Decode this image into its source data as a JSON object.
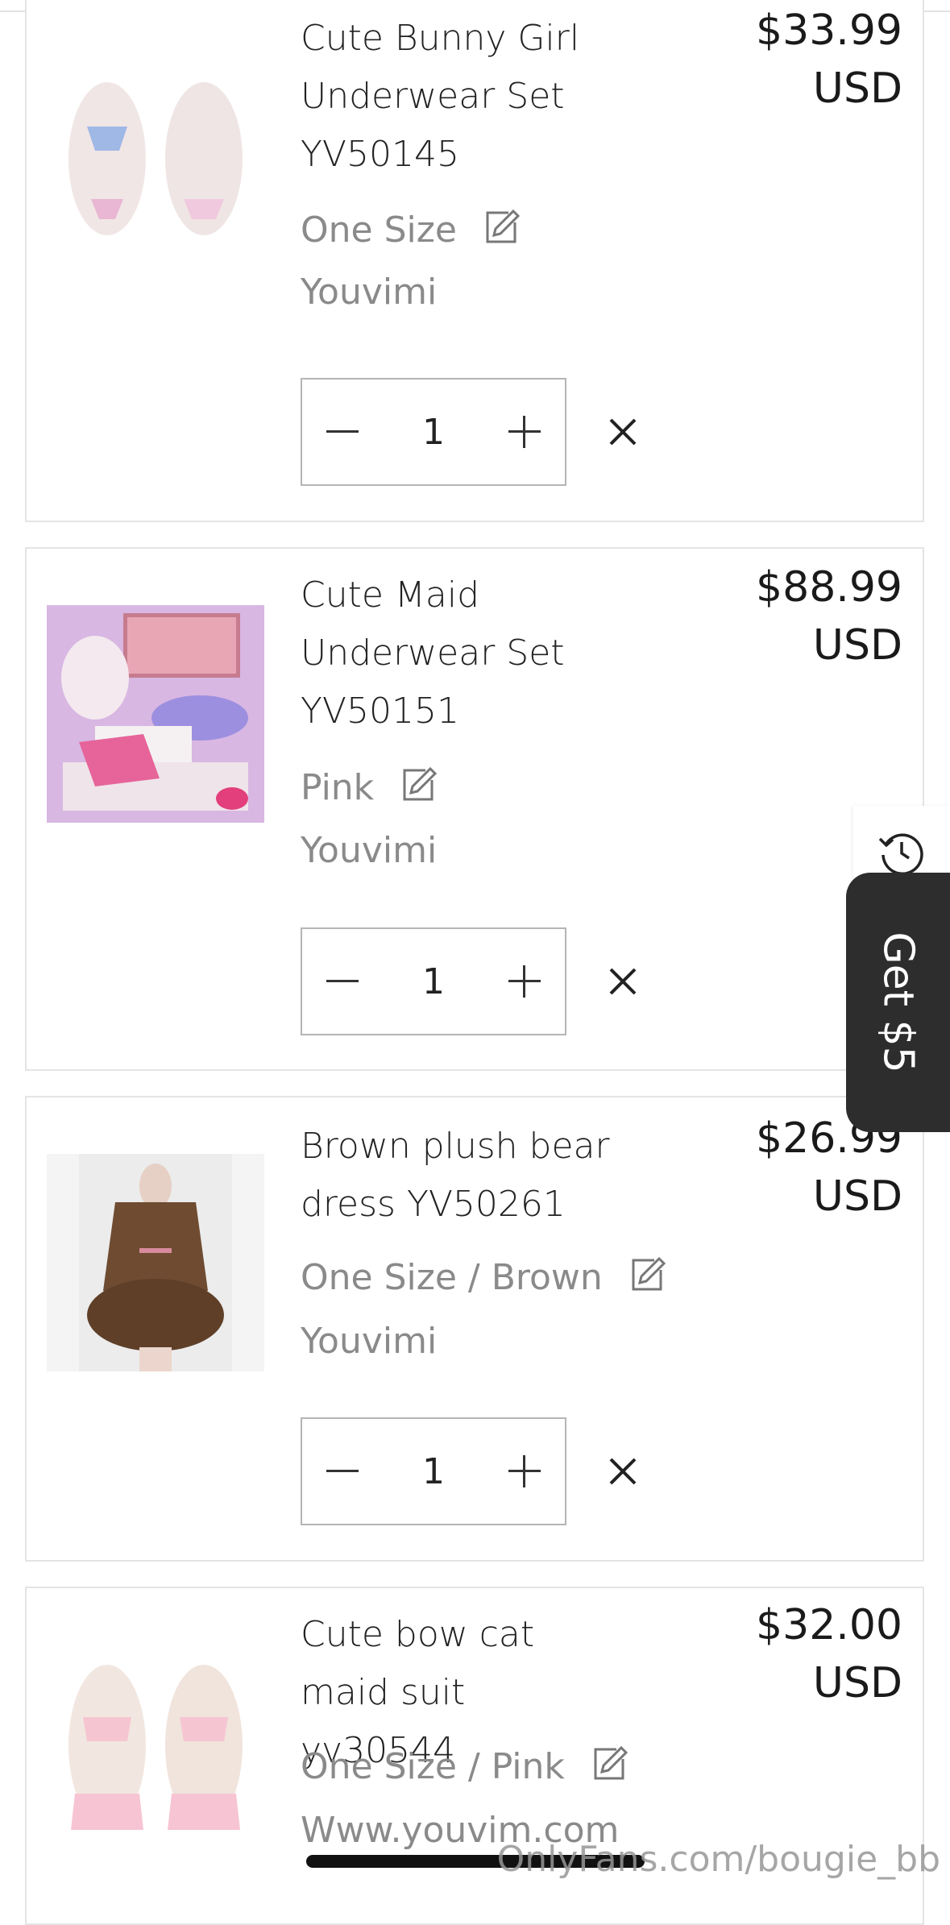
{
  "items": [
    {
      "title": "Cute Bunny Girl Underwear Set YV50145",
      "price": "$33.99",
      "currency": "USD",
      "variant": "One Size",
      "vendor": "Youvimi",
      "quantity": "1"
    },
    {
      "title": "Cute Maid Underwear Set YV50151",
      "price": "$88.99",
      "currency": "USD",
      "variant": "Pink",
      "vendor": "Youvimi",
      "quantity": "1"
    },
    {
      "title": "Brown plush bear dress YV50261",
      "price": "$26.99",
      "currency": "USD",
      "variant": "One Size / Brown",
      "vendor": "Youvimi",
      "quantity": "1"
    },
    {
      "title": "Cute bow cat maid suit yv30544",
      "price": "$32.00",
      "currency": "USD",
      "variant": "One Size / Pink",
      "vendor": "Www.youvim.com"
    }
  ],
  "side_tab": {
    "label": "Get $5"
  },
  "watermark": "OnlyFans.com/bougie_bb",
  "icons": {
    "edit": "edit-icon",
    "minus": "minus-icon",
    "plus": "plus-icon",
    "remove": "close-icon",
    "history": "history-icon"
  }
}
